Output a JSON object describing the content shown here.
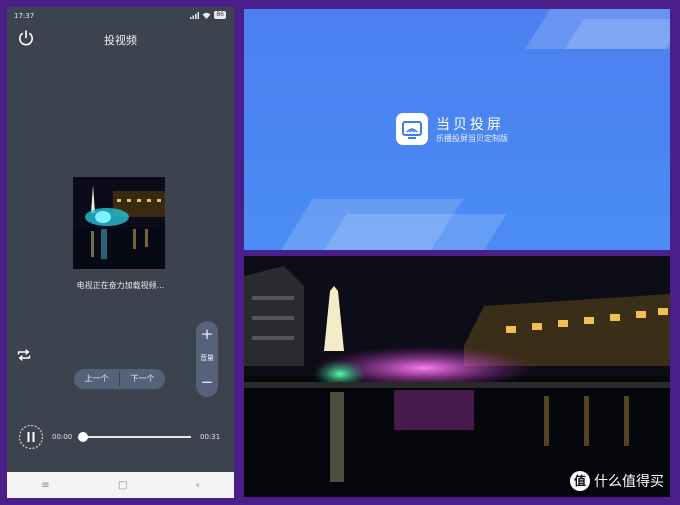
{
  "status_bar": {
    "time": "17:37",
    "battery": "86"
  },
  "header": {
    "title": "投视频"
  },
  "player": {
    "loading_text": "电视正在奋力加载视频...",
    "volume_plus": "+",
    "volume_label": "音量",
    "volume_minus": "−",
    "prev_label": "上一个",
    "next_label": "下一个",
    "time_current": "00:00",
    "time_total": "00:31",
    "progress": 0
  },
  "nav": {
    "menu": "≡",
    "home": "□",
    "back": "‹"
  },
  "splash": {
    "app_name": "当贝投屏",
    "subtitle": "乐播投屏当贝定制版",
    "brand_color": "#4a86f2"
  },
  "watermark": {
    "badge": "值",
    "text": "什么值得买"
  },
  "icons": [
    "power-icon",
    "repeat-icon",
    "play-pause-icon",
    "cast-icon"
  ]
}
